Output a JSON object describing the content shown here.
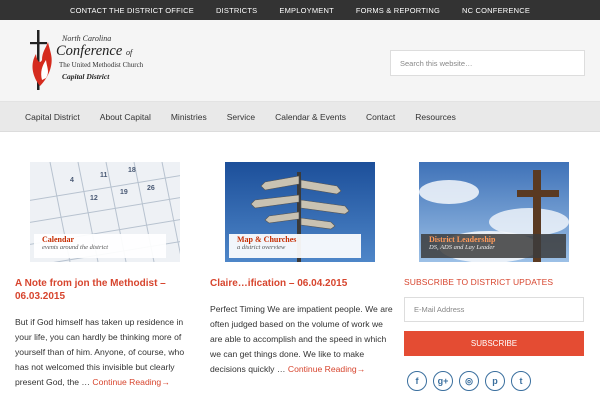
{
  "topbar": {
    "items": [
      "CONTACT THE DISTRICT OFFICE",
      "DISTRICTS",
      "EMPLOYMENT",
      "FORMS & REPORTING",
      "NC CONFERENCE"
    ]
  },
  "logo": {
    "line1": "North Carolina",
    "line2": "Conference",
    "line2_of": "of",
    "line3": "The United Methodist Church",
    "line4": "Capital District"
  },
  "search": {
    "placeholder": "Search this website…"
  },
  "nav": {
    "items": [
      "Capital District",
      "About Capital",
      "Ministries",
      "Service",
      "Calendar & Events",
      "Contact",
      "Resources"
    ]
  },
  "cards": [
    {
      "banner_title": "Calendar",
      "banner_sub": "events around the district"
    },
    {
      "banner_title": "Map & Churches",
      "banner_sub": "a district overview"
    },
    {
      "banner_title": "District Leadership",
      "banner_sub": "DS, ADS and Lay Leader"
    }
  ],
  "posts": [
    {
      "title_line1": "A Note from jon the Methodist –",
      "title_line2": "06.03.2015",
      "body": "But if God himself has taken up residence in your life, you can hardly be thinking more of yourself than of him. Anyone, of course, who has not welcomed this invisible but clearly present God, the …",
      "more": "Continue Reading→"
    },
    {
      "title_line1": "Claire…ification – 06.04.2015",
      "body": "Perfect Timing We are impatient people. We are often judged based on the volume of work we are able to accomplish and the speed in which we can get things done. We like to make decisions quickly …",
      "more": "Continue Reading→"
    }
  ],
  "subscribe": {
    "title": "SUBSCRIBE TO DISTRICT UPDATES",
    "email_placeholder": "E-Mail Address",
    "button": "SUBSCRIBE"
  },
  "social": {
    "icons": [
      {
        "name": "facebook-icon",
        "glyph": "f"
      },
      {
        "name": "google-plus-icon",
        "glyph": "g+"
      },
      {
        "name": "instagram-icon",
        "glyph": "◎"
      },
      {
        "name": "pinterest-icon",
        "glyph": "p"
      },
      {
        "name": "tumblr-icon",
        "glyph": "t"
      }
    ]
  },
  "colors": {
    "accent": "#d7452e",
    "topbar": "#333333",
    "button": "#e44c33",
    "social": "#3a6f9e"
  }
}
